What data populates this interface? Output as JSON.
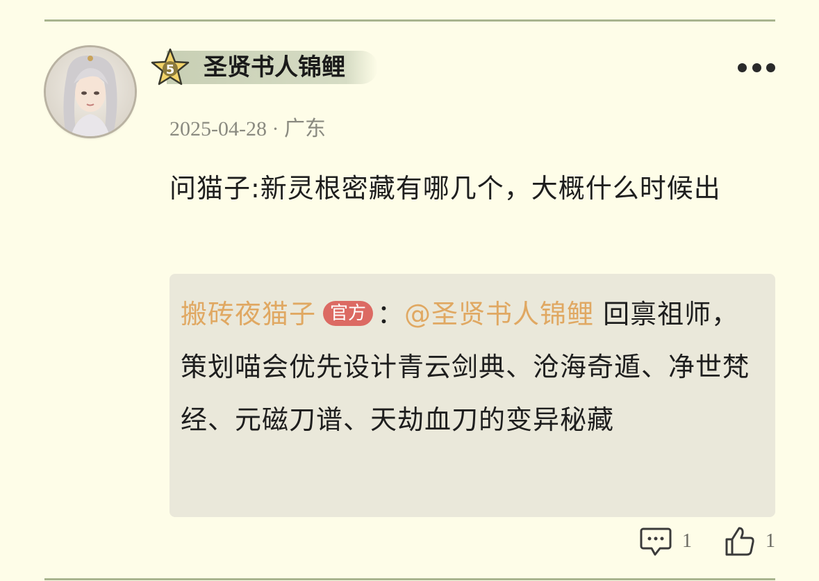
{
  "user": {
    "name": "圣贤书人锦鲤",
    "level": "5"
  },
  "meta": {
    "date": "2025-04-28",
    "separator": " · ",
    "location": "广东"
  },
  "comment": {
    "text": "问猫子:新灵根密藏有哪几个，大概什么时候出"
  },
  "reply": {
    "author": "搬砖夜猫子",
    "badge": "官方",
    "colon": "：",
    "mention": "@圣贤书人锦鲤",
    "text": " 回禀祖师，策划喵会优先设计青云剑典、沧海奇遁、净世梵经、元磁刀谱、天劫血刀的变异秘藏"
  },
  "actions": {
    "reply_count": "1",
    "like_count": "1"
  },
  "colors": {
    "background": "#fefde8",
    "divider": "#a8b48e",
    "name_pill": "#d1d8bd",
    "reply_background": "#eae8da",
    "author_color": "#e0a862",
    "badge_color": "#dc6a63"
  },
  "icons": {
    "more": "more-dots-icon",
    "star": "level-star-icon",
    "comment": "comment-bubble-icon",
    "like": "thumbs-up-icon"
  }
}
